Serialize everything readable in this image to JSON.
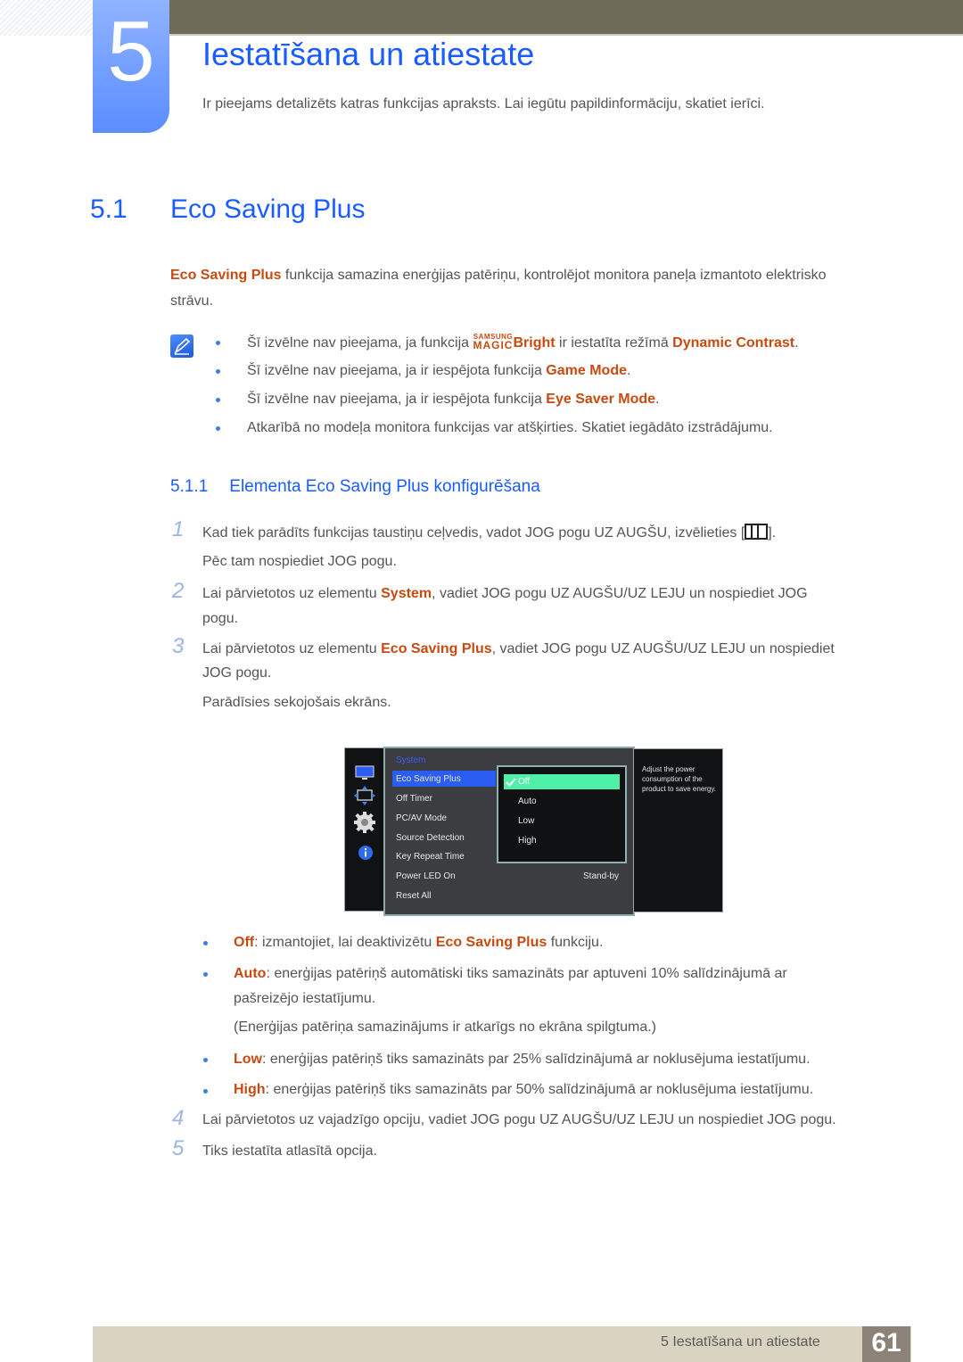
{
  "chapter": {
    "number": "5",
    "title": "Iestatīšana un atiestate",
    "intro": "Ir pieejams detalizēts katras funkcijas apraksts. Lai iegūtu papildinformāciju, skatiet ierīci."
  },
  "section": {
    "number": "5.1",
    "title": "Eco Saving Plus",
    "para_hl": "Eco Saving Plus",
    "para_rest": " funkcija samazina enerģijas patēriņu, kontrolējot monitora paneļa izmantoto elektrisko",
    "para_line2": "strāvu."
  },
  "notes": {
    "icon": "note-pencil-icon",
    "n1_pre": "Šī izvēlne nav pieejama, ja funkcija ",
    "n1_magic_top": "SAMSUNG",
    "n1_magic_bottom": "MAGIC",
    "n1_bright": "Bright",
    "n1_mid": " ir iestatīta režīmā ",
    "n1_hl": "Dynamic Contrast",
    "n1_end": ".",
    "n2_pre": "Šī izvēlne nav pieejama, ja ir iespējota funkcija ",
    "n2_hl": "Game Mode",
    "n2_end": ".",
    "n3_pre": "Šī izvēlne nav pieejama, ja ir iespējota funkcija ",
    "n3_hl": "Eye Saver Mode",
    "n3_end": ".",
    "n4": "Atkarībā no modeļa monitora funkcijas var atšķirties. Skatiet iegādāto izstrādājumu."
  },
  "subsection": {
    "number": "5.1.1",
    "title": "Elementa Eco Saving Plus konfigurēšana"
  },
  "steps": {
    "s1_num": "1",
    "s1_a": "Kad tiek parādīts funkcijas taustiņu ceļvedis, vadot JOG pogu UZ AUGŠU, izvēlieties [",
    "s1_b": "].",
    "s1_icon": "menu-icon",
    "s1_line2": "Pēc tam nospiediet JOG pogu.",
    "s2_num": "2",
    "s2_pre": "Lai pārvietotos uz elementu ",
    "s2_hl": "System",
    "s2_rest": ", vadiet JOG pogu UZ AUGŠU/UZ LEJU un nospiediet JOG",
    "s2_line2": "pogu.",
    "s3_num": "3",
    "s3_pre": "Lai pārvietotos uz elementu ",
    "s3_hl": "Eco Saving Plus",
    "s3_rest": ", vadiet JOG pogu UZ AUGŠU/UZ LEJU un nospiediet",
    "s3_line2": "JOG pogu.",
    "s3_line3": "Parādīsies sekojošais ekrāns.",
    "s4_num": "4",
    "s4": "Lai pārvietotos uz vajadzīgo opciju, vadiet JOG pogu UZ AUGŠU/UZ LEJU un nospiediet JOG pogu.",
    "s5_num": "5",
    "s5": "Tiks iestatīta atlasītā opcija."
  },
  "osd": {
    "icons": [
      "monitor-icon",
      "resize-arrows-icon",
      "gear-icon",
      "info-icon"
    ],
    "category": "System",
    "items": [
      "Eco Saving Plus",
      "Off Timer",
      "PC/AV Mode",
      "Source Detection",
      "Key Repeat Time",
      "Power LED On",
      "Reset All"
    ],
    "selected_item": "Eco Saving Plus",
    "options": [
      "Off",
      "Auto",
      "Low",
      "High"
    ],
    "selected_option": "Off",
    "power_led_value": "Stand-by",
    "description": "Adjust the power consumption of the product to save energy.",
    "colors": {
      "highlight": "#2a5df0",
      "option_selected": "#4ef0a8"
    }
  },
  "options_desc": {
    "off_hl": "Off",
    "off_pre": ": izmantojiet, lai deaktivizētu ",
    "off_hl2": "Eco Saving Plus",
    "off_end": " funkciju.",
    "auto_hl": "Auto",
    "auto_rest": ": enerģijas patēriņš automātiski tiks samazināts par aptuveni 10% salīdzinājumā ar",
    "auto_line2": "pašreizējo iestatījumu.",
    "auto_line3": "(Enerģijas patēriņa samazinājums ir atkarīgs no ekrāna spilgtuma.)",
    "low_hl": "Low",
    "low_rest": ": enerģijas patēriņš tiks samazināts par 25% salīdzinājumā ar noklusējuma iestatījumu.",
    "high_hl": "High",
    "high_rest": ": enerģijas patēriņš tiks samazināts par 50% salīdzinājumā ar noklusējuma iestatījumu."
  },
  "footer": {
    "chapter_label": "5 Iestatīšana un atiestate",
    "page": "61"
  },
  "colors": {
    "accent_blue": "#1a5cff",
    "highlight_orange": "#c74a10",
    "header_bar": "#6d6a58",
    "footer_bar": "#d9d4c2"
  }
}
